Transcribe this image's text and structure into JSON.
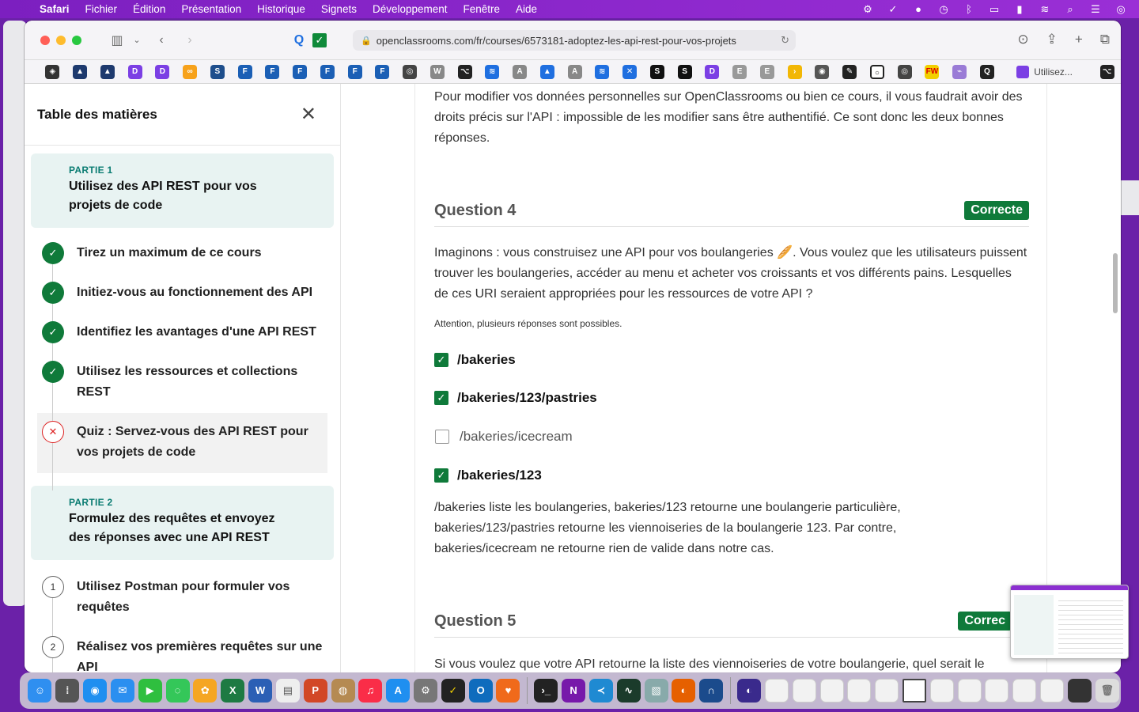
{
  "menubar": {
    "app": "Safari",
    "items": [
      "Fichier",
      "Édition",
      "Présentation",
      "Historique",
      "Signets",
      "Développement",
      "Fenêtre",
      "Aide"
    ]
  },
  "browser": {
    "url": "openclassrooms.com/fr/courses/6573181-adoptez-les-api-rest-pour-vos-projets",
    "pinned_tab_label": "Utilisez..."
  },
  "sidebar": {
    "title": "Table des matières",
    "parts": [
      {
        "label": "PARTIE 1",
        "title": "Utilisez des API REST pour vos projets de code",
        "chapters": [
          {
            "status": "done",
            "marker": "✓",
            "title": "Tirez un maximum de ce cours"
          },
          {
            "status": "done",
            "marker": "✓",
            "title": "Initiez-vous au fonctionnement des API"
          },
          {
            "status": "done",
            "marker": "✓",
            "title": "Identifiez les avantages d'une API REST"
          },
          {
            "status": "done",
            "marker": "✓",
            "title": "Utilisez les ressources et collections REST"
          },
          {
            "status": "fail",
            "marker": "✕",
            "title": "Quiz : Servez-vous des API REST pour vos projets de code"
          }
        ]
      },
      {
        "label": "PARTIE 2",
        "title": "Formulez des requêtes et envoyez des réponses avec une API REST",
        "chapters": [
          {
            "status": "todo",
            "marker": "1",
            "title": "Utilisez Postman pour formuler vos requêtes"
          },
          {
            "status": "todo",
            "marker": "2",
            "title": "Réalisez vos premières requêtes sur une API"
          }
        ]
      }
    ]
  },
  "content": {
    "prev_explanation": "Pour modifier vos données personnelles sur OpenClassrooms ou bien ce cours, il vous faudrait avoir des droits précis sur l'API : impossible de les modifier sans être authentifié. Ce sont donc les deux bonnes réponses.",
    "question4": {
      "title": "Question 4",
      "badge": "Correcte",
      "prompt": "Imaginons : vous construisez une API pour vos boulangeries 🥖. Vous voulez que les utilisateurs puissent trouver les boulangeries, accéder au menu et acheter vos croissants et vos différents pains. Lesquelles de ces URI seraient appropriées pour les ressources de votre API ?",
      "note": "Attention, plusieurs réponses sont possibles.",
      "options": [
        {
          "label": "/bakeries",
          "checked": true
        },
        {
          "label": "/bakeries/123/pastries",
          "checked": true
        },
        {
          "label": "/bakeries/icecream",
          "checked": false
        },
        {
          "label": "/bakeries/123",
          "checked": true
        }
      ],
      "explanation": "/bakeries liste les boulangeries, bakeries/123 retourne une boulangerie particulière, bakeries/123/pastries retourne les viennoiseries de la boulangerie 123. Par contre, bakeries/icecream ne retourne rien de valide dans notre cas."
    },
    "question5": {
      "title": "Question 5",
      "badge": "Correc",
      "prompt": "Si vous voulez que votre API retourne la liste des viennoiseries de votre boulangerie, quel serait le"
    }
  },
  "colors": {
    "accent_green": "#0f7a3a",
    "part_bg": "#e8f3f2",
    "part_label": "#0a7c72",
    "menubar": "#8a27cc"
  }
}
